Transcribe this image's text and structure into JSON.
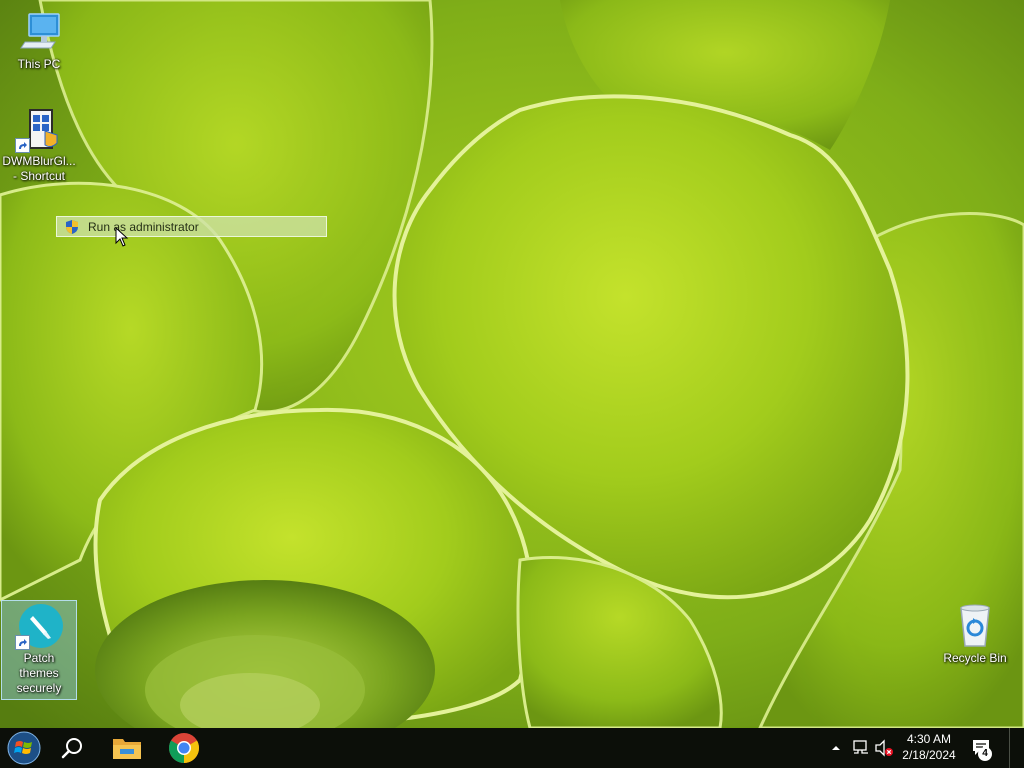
{
  "desktop": {
    "icons": [
      {
        "label": "This PC",
        "icon": "computer-monitor-icon"
      },
      {
        "label": "DWMBlurGl... - Shortcut",
        "icon": "dwmblurglass-app-icon"
      },
      {
        "label": "Patch themes securely",
        "icon": "paintbrush-app-icon"
      },
      {
        "label": "Recycle Bin",
        "icon": "recycle-bin-icon"
      }
    ],
    "context_menu": {
      "items": [
        {
          "label": "Run as administrator",
          "icon": "uac-shield-icon"
        }
      ]
    }
  },
  "taskbar": {
    "start_icon": "windows-start-orb-icon",
    "search_icon": "search-icon",
    "pinned": [
      {
        "name": "File Explorer",
        "icon": "file-explorer-icon",
        "running": false
      },
      {
        "name": "Google Chrome",
        "icon": "chrome-icon",
        "running": false
      }
    ],
    "tray": {
      "chevron_icon": "chevron-up-icon",
      "network_icon": "network-disconnected-icon",
      "volume_icon": "volume-muted-icon",
      "time": "4:30 AM",
      "date": "2/18/2024",
      "notifications_icon": "action-center-icon",
      "notification_count": "4"
    }
  },
  "colors": {
    "taskbar": "#0c0f09",
    "selection": "#8cc8eb",
    "wallpaper_green": "#8fbd1f"
  }
}
